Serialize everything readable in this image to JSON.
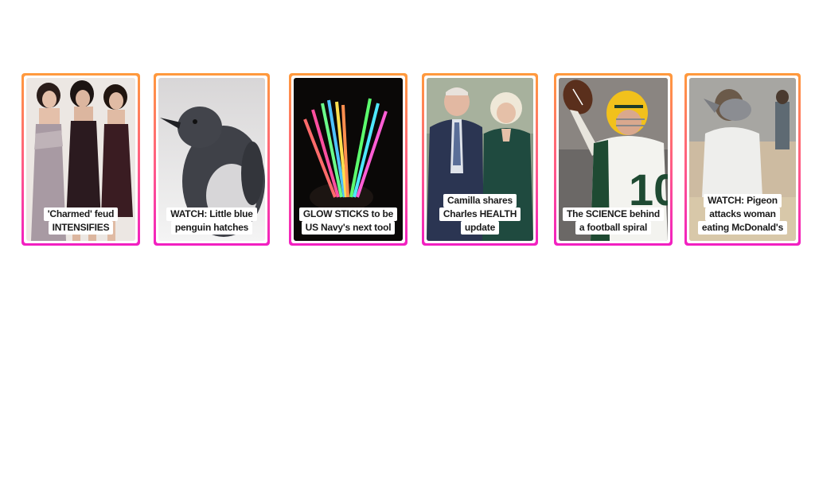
{
  "stories": [
    {
      "caption_lines": [
        "'Charmed' feud",
        "INTENSIFIES"
      ]
    },
    {
      "caption_lines": [
        "WATCH: Little blue",
        "penguin hatches"
      ]
    },
    {
      "caption_lines": [
        "GLOW STICKS to be",
        "US Navy's next tool"
      ]
    },
    {
      "caption_lines": [
        "Camilla shares",
        "Charles HEALTH",
        "update"
      ]
    },
    {
      "caption_lines": [
        "The SCIENCE behind",
        "a football spiral"
      ]
    },
    {
      "caption_lines": [
        "WATCH: Pigeon",
        "attacks woman",
        "eating McDonald's"
      ]
    }
  ],
  "colors": {
    "ring_top": "#ff9a3c",
    "ring_mid": "#ff5a88",
    "ring_bottom": "#f21fc2",
    "caption_bg": "#ffffff",
    "caption_text": "#1a1a1a"
  }
}
